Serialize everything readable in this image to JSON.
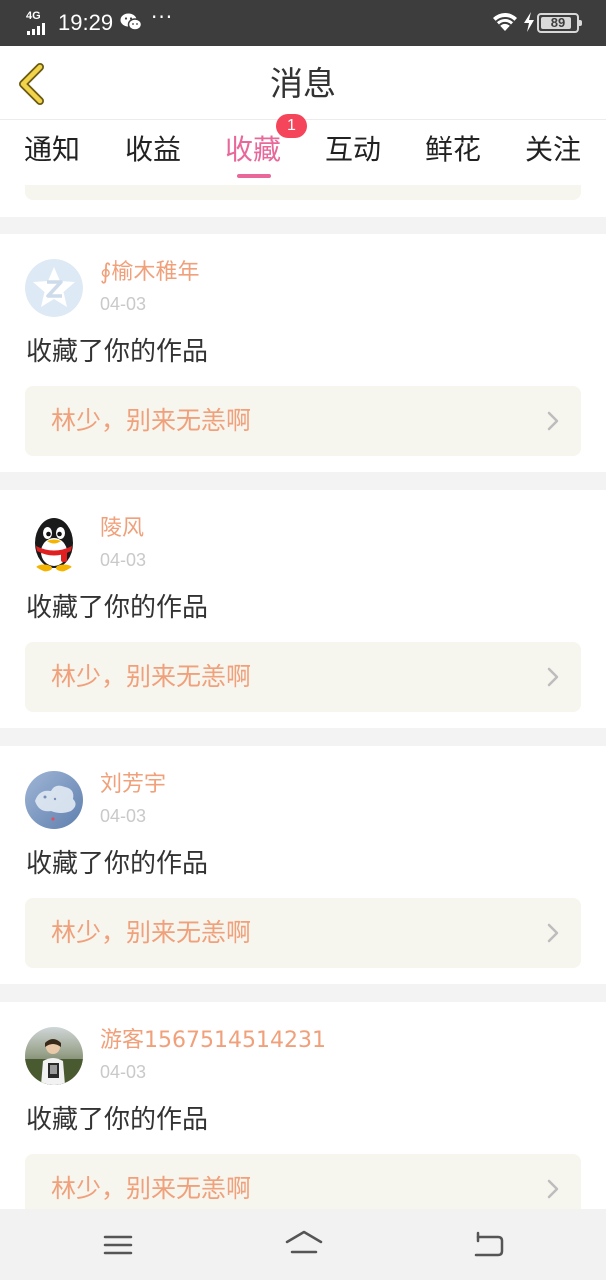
{
  "status_bar": {
    "network": "4G",
    "time": "19:29",
    "dots": "···",
    "battery": "89"
  },
  "header": {
    "title": "消息",
    "back_icon": "chevron-left-icon"
  },
  "tabs": [
    {
      "label": "通知",
      "active": false
    },
    {
      "label": "收益",
      "active": false
    },
    {
      "label": "收藏",
      "active": true,
      "badge": "1"
    },
    {
      "label": "互动",
      "active": false
    },
    {
      "label": "鲜花",
      "active": false
    },
    {
      "label": "关注",
      "active": false
    }
  ],
  "colors": {
    "accent": "#e8689a",
    "name": "#f0a07a",
    "badge": "#f5455a",
    "card_link_bg": "#f6f5ee"
  },
  "messages": [
    {
      "name": "∮榆木稚年",
      "date": "04-03",
      "action": "收藏了你的作品",
      "work": "林少，别来无恙啊",
      "avatar": "qzone-star-avatar"
    },
    {
      "name": "陵风",
      "date": "04-03",
      "action": "收藏了你的作品",
      "work": "林少，别来无恙啊",
      "avatar": "qq-penguin-avatar"
    },
    {
      "name": "刘芳宇",
      "date": "04-03",
      "action": "收藏了你的作品",
      "work": "林少，别来无恙啊",
      "avatar": "sky-cloud-avatar"
    },
    {
      "name": "游客1567514514231",
      "date": "04-03",
      "action": "收藏了你的作品",
      "work": "林少，别来无恙啊",
      "avatar": "photo-person-avatar"
    }
  ],
  "nav_bar": {
    "icons": [
      "menu-icon",
      "home-icon",
      "back-icon"
    ]
  }
}
